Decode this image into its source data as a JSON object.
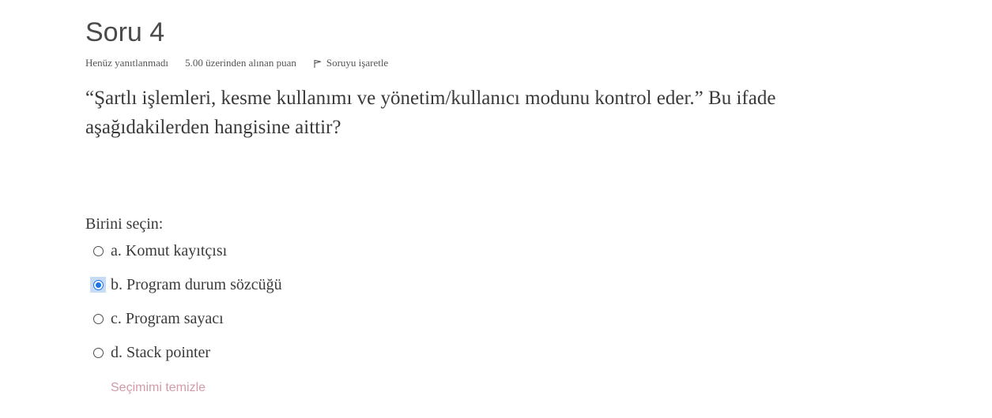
{
  "question": {
    "title": "Soru 4",
    "state": "Henüz yanıtlanmadı",
    "grade": "5.00 üzerinden alınan puan",
    "flag_label": "Soruyu işaretle",
    "flag_icon": "flag-icon",
    "text": "“Şartlı işlemleri, kesme kullanımı ve yönetim/kullanıcı modunu kontrol eder.” Bu ifade aşağıdakilerden hangisine aittir?",
    "prompt": "Birini seçin:",
    "options": [
      {
        "label": "a. Komut kayıtçısı",
        "selected": false
      },
      {
        "label": "b. Program durum sözcüğü",
        "selected": true
      },
      {
        "label": "c. Program sayacı",
        "selected": false
      },
      {
        "label": "d. Stack pointer",
        "selected": false
      }
    ],
    "clear_label": "Seçimimi temizle"
  },
  "colors": {
    "text": "#3a3a3a",
    "radio_selected": "#1a73e8",
    "focus_highlight": "#c7dcf4",
    "clear_link": "#d39aa9"
  }
}
